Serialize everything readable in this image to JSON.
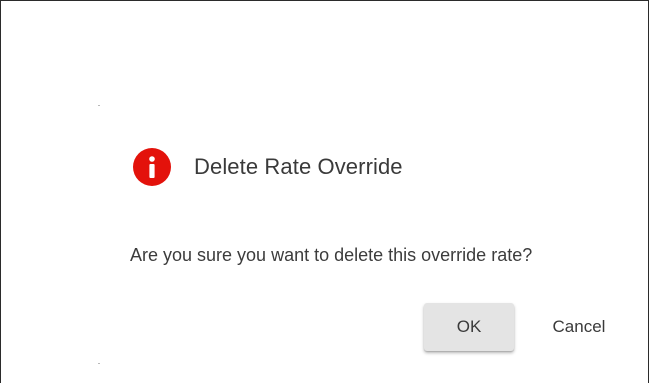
{
  "dialog": {
    "title": "Delete Rate Override",
    "message": "Are you sure you want to delete this override rate?",
    "icon": "alert-circle-icon",
    "icon_color": "#e3120b",
    "ok_label": "OK",
    "cancel_label": "Cancel"
  }
}
